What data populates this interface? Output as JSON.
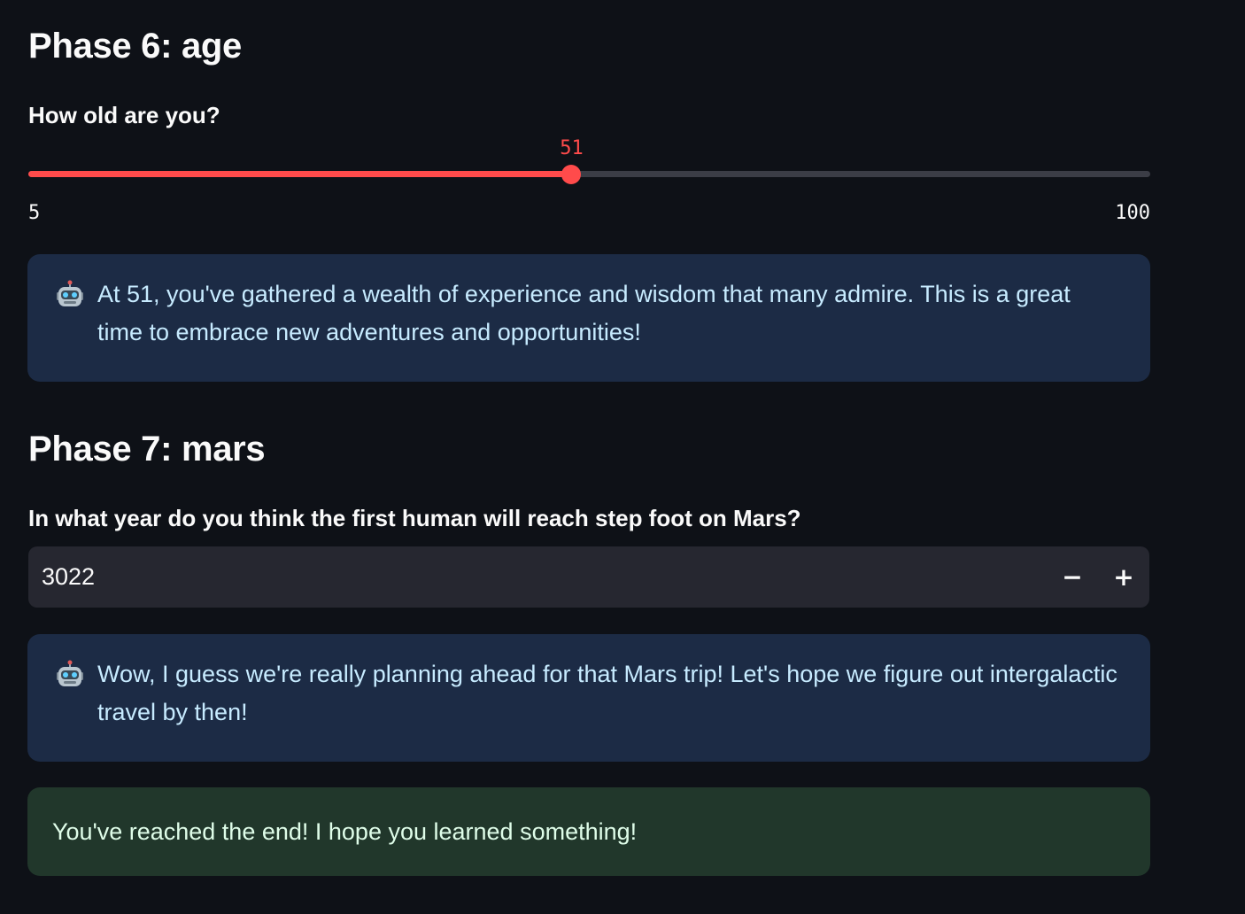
{
  "phase6": {
    "heading": "Phase 6: age",
    "question": "How old are you?",
    "slider": {
      "value": "51",
      "min": "5",
      "max": "100",
      "fraction": 0.4842,
      "accent": "#ff4b4b"
    },
    "response": {
      "icon": "robot-icon",
      "text": "At 51, you've gathered a wealth of experience and wisdom that many admire. This is a great time to embrace new adventures and opportunities!"
    }
  },
  "phase7": {
    "heading": "Phase 7: mars",
    "question": "In what year do you think the first human will reach step foot on Mars?",
    "input": {
      "value": "3022",
      "decrement": "−",
      "increment": "+"
    },
    "response": {
      "icon": "robot-icon",
      "text": "Wow, I guess we're really planning ahead for that Mars trip! Let's hope we figure out intergalactic travel by then!"
    }
  },
  "end_message": "You've reached the end! I hope you learned something!",
  "colors": {
    "background": "#0e1117",
    "info_bg": "#1c2b45",
    "info_text": "#c7ebff",
    "success_bg": "#21372b",
    "success_text": "#dffde9"
  }
}
